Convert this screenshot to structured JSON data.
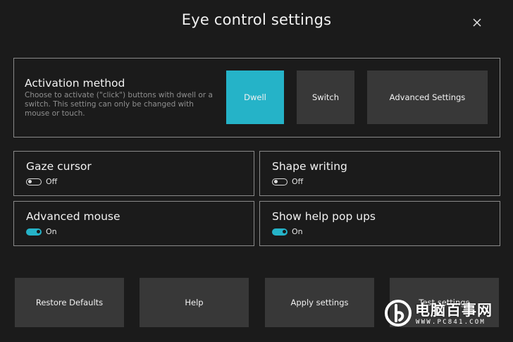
{
  "window": {
    "title": "Eye control settings",
    "close_icon": "close-icon"
  },
  "activation": {
    "heading": "Activation method",
    "description": "Choose to activate (\"click\") buttons with dwell or a switch. This setting can only be changed with mouse or touch.",
    "buttons": {
      "dwell": "Dwell",
      "switch": "Switch",
      "advanced": "Advanced Settings"
    },
    "selected": "Dwell"
  },
  "toggles": {
    "gaze_cursor": {
      "label": "Gaze cursor",
      "state": "Off"
    },
    "shape_writing": {
      "label": "Shape writing",
      "state": "Off"
    },
    "advanced_mouse": {
      "label": "Advanced mouse",
      "state": "On"
    },
    "help_popups": {
      "label": "Show help pop ups",
      "state": "On"
    }
  },
  "footer": {
    "restore": "Restore Defaults",
    "help": "Help",
    "apply": "Apply settings",
    "test": "Test settings"
  },
  "watermark": {
    "title": "电脑百事网",
    "url": "WWW.PC841.COM"
  },
  "colors": {
    "background": "#1b1b1b",
    "accent": "#25b3c8",
    "button": "#383838",
    "border": "#8a8a8a"
  }
}
